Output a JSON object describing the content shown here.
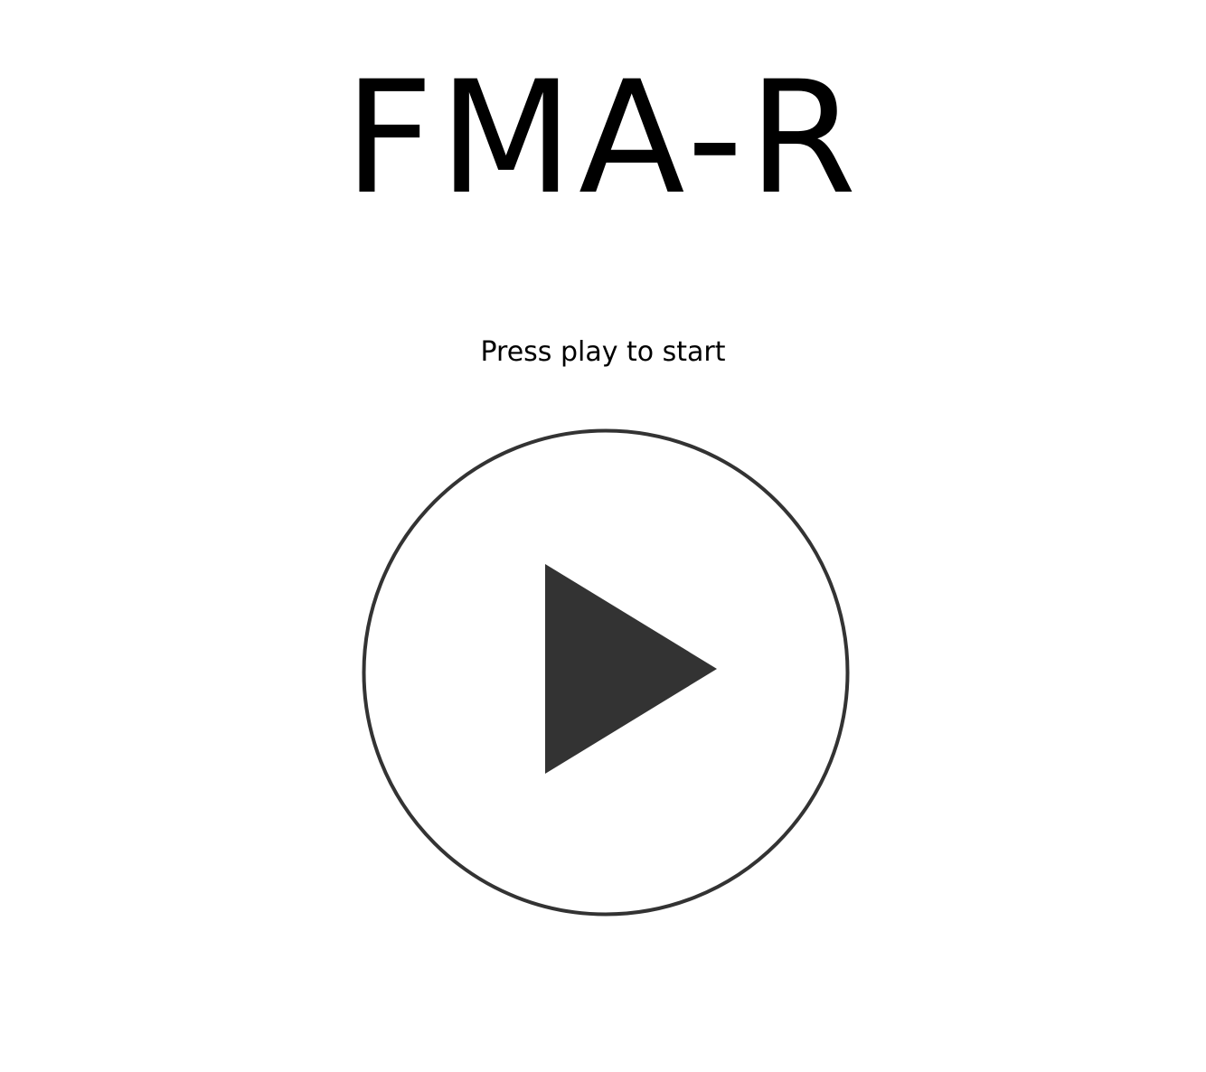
{
  "app": {
    "title": "FMA-R"
  },
  "main": {
    "prompt": "Press play to start"
  },
  "play_button": {
    "icon": "play-icon",
    "ring_color": "#333333",
    "triangle_color": "#333333",
    "background": "#ffffff"
  }
}
